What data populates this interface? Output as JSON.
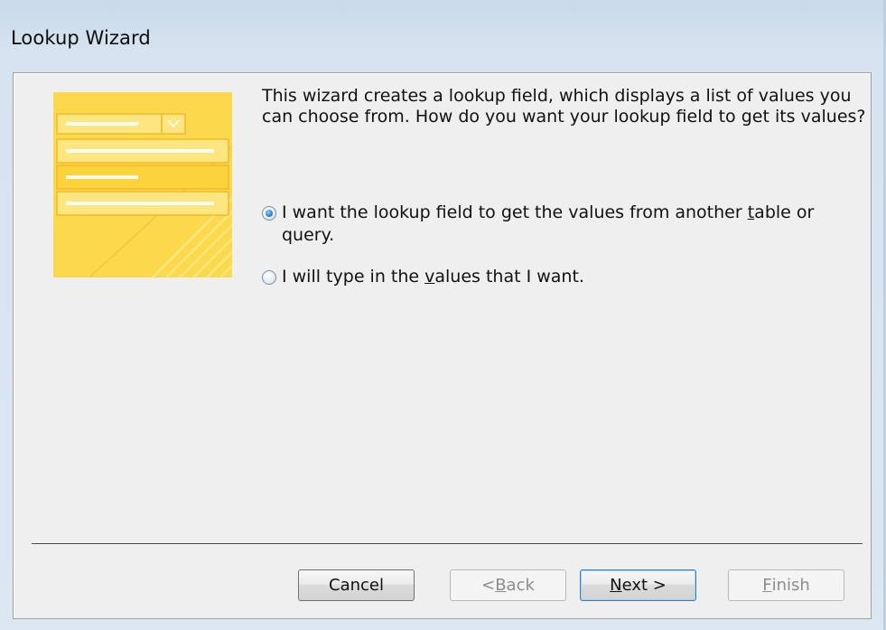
{
  "window": {
    "title": "Lookup Wizard"
  },
  "intro_text": "This wizard creates a lookup field, which displays a list of values you can choose from.  How do you want your lookup field to get its values?",
  "options": [
    {
      "pre": "I want the lookup field to get the values from another ",
      "mnemonic": "t",
      "post": "able or query.",
      "checked": true
    },
    {
      "pre": "I will type in the ",
      "mnemonic": "v",
      "post": "alues that I want.",
      "checked": false
    }
  ],
  "buttons": {
    "cancel": "Cancel",
    "back_pre": "< ",
    "back_mnemonic": "B",
    "back_post": "ack",
    "next_mnemonic": "N",
    "next_post": "ext >",
    "finish_mnemonic": "F",
    "finish_post": "inish"
  },
  "colors": {
    "illustration_yellow": "#fcd33c",
    "illustration_light": "#fde680",
    "illustration_dark": "#f0b92a",
    "accent_blue": "#3c7fb1"
  },
  "icons": [
    "wizard-illustration-icon",
    "dropdown-arrow-icon",
    "radio-selected-icon",
    "radio-unselected-icon"
  ]
}
